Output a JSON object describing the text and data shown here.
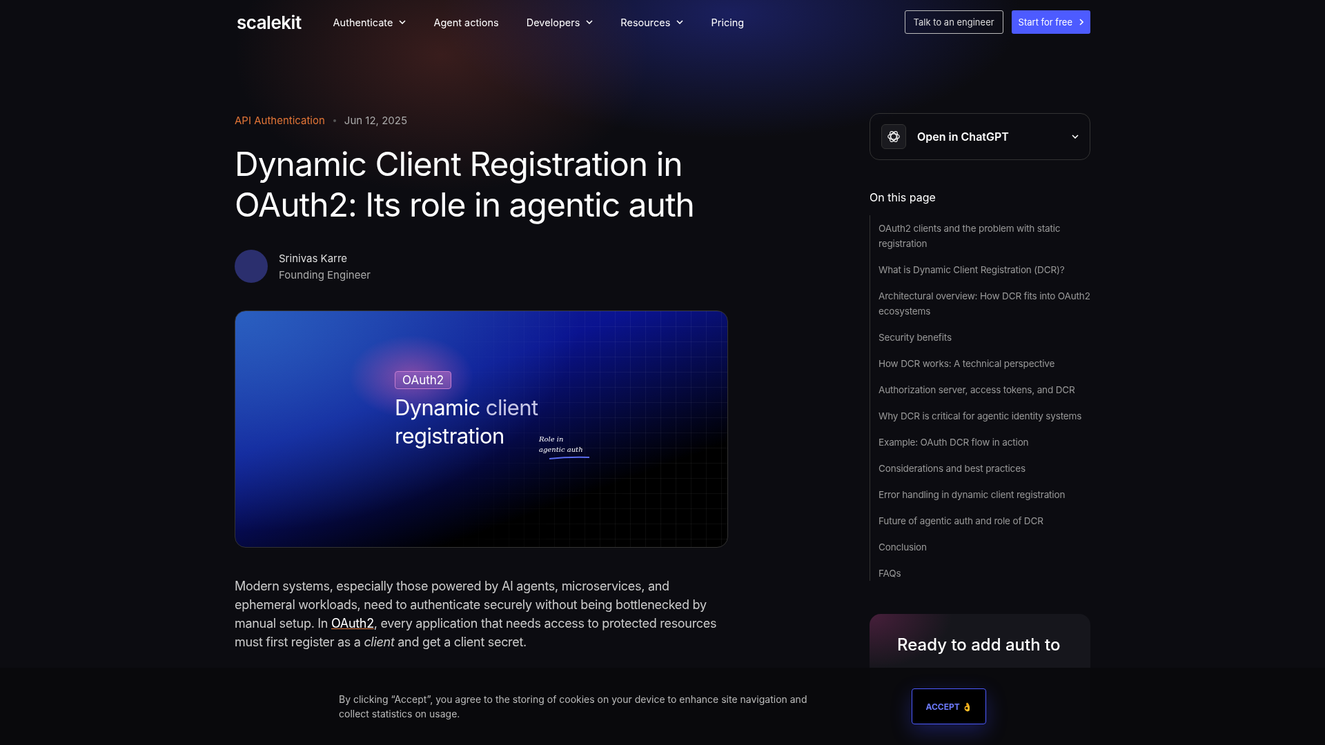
{
  "nav": {
    "logo": "scalekit",
    "items": [
      {
        "label": "Authenticate",
        "dropdown": true
      },
      {
        "label": "Agent actions",
        "dropdown": false
      },
      {
        "label": "Developers",
        "dropdown": true
      },
      {
        "label": "Resources",
        "dropdown": true
      },
      {
        "label": "Pricing",
        "dropdown": false
      }
    ],
    "secondary_button": "Talk to an engineer",
    "primary_button": "Start for free"
  },
  "article": {
    "category": "API Authentication",
    "date": "Jun 12, 2025",
    "title": "Dynamic Client Registration in OAuth2: Its role in agentic auth",
    "author": {
      "name": "Srinivas Karre",
      "role": "Founding Engineer"
    },
    "hero": {
      "tag": "OAuth2",
      "headline_1": "Dynamic ",
      "headline_2": "client",
      "headline_3": "registration",
      "note_1": "Role in",
      "note_2": "agentic auth"
    },
    "intro": {
      "before": "Modern systems, especially those powered by AI agents, microservices, and ephemeral workloads, need to authenticate securely without being bottlenecked by manual setup. In ",
      "link": "OAuth2",
      "after": ", every application that needs access to protected resources must first register as a *client* and get a client secret."
    }
  },
  "sidebar": {
    "chatgpt_button": "Open in ChatGPT",
    "toc_title": "On this page",
    "toc": [
      "OAuth2 clients and the problem with static registration",
      "What is Dynamic Client Registration (DCR)?",
      "Architectural overview: How DCR fits into OAuth2 ecosystems",
      "Security benefits",
      "How DCR works: A technical perspective",
      "Authorization server, access tokens, and DCR",
      "Why DCR is critical for agentic identity systems",
      "Example: OAuth DCR flow in action",
      "Considerations and best practices",
      "Error handling in dynamic client registration",
      "Future of agentic auth and role of DCR",
      "Conclusion",
      "FAQs"
    ],
    "cta_title": "Ready to add auth to"
  },
  "cookie_banner": {
    "text": "By clicking “Accept”, you agree to the storing of cookies on your device to enhance site navigation and collect statistics on usage.",
    "accept_button": "ACCEPT 👌"
  }
}
